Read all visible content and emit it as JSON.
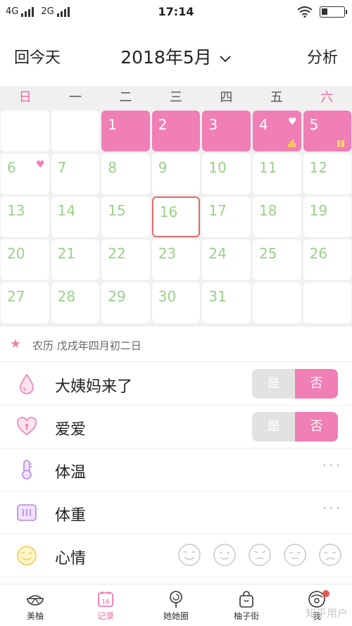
{
  "status": {
    "net1": "4G",
    "net2": "2G",
    "time": "17:14"
  },
  "header": {
    "back": "回今天",
    "title": "2018年5月",
    "right": "分析"
  },
  "calendar": {
    "weekdays": [
      "日",
      "一",
      "二",
      "三",
      "四",
      "五",
      "六"
    ],
    "weeks": [
      [
        "",
        "",
        "1",
        "2",
        "3",
        "4",
        "5"
      ],
      [
        "6",
        "7",
        "8",
        "9",
        "10",
        "11",
        "12"
      ],
      [
        "13",
        "14",
        "15",
        "16",
        "17",
        "18",
        "19"
      ],
      [
        "20",
        "21",
        "22",
        "23",
        "24",
        "25",
        "26"
      ],
      [
        "27",
        "28",
        "29",
        "30",
        "31",
        "",
        ""
      ]
    ],
    "period_days": [
      "1",
      "2",
      "3",
      "4",
      "5"
    ],
    "today": "16",
    "heart_days": [
      "4",
      "6"
    ],
    "accent_color": "#f07fb5"
  },
  "lunar": {
    "text": "农历 戊戌年四月初二日"
  },
  "rows": {
    "period": {
      "label": "大姨妈来了",
      "yes": "是",
      "no": "否"
    },
    "love": {
      "label": "爱爱",
      "yes": "是",
      "no": "否"
    },
    "temp": {
      "label": "体温",
      "more": "···"
    },
    "weight": {
      "label": "体重",
      "more": "···"
    },
    "mood": {
      "label": "心情"
    }
  },
  "nav": {
    "items": [
      {
        "label": "美柚"
      },
      {
        "label": "记录"
      },
      {
        "label": "她她圈"
      },
      {
        "label": "柚子街"
      },
      {
        "label": "我"
      }
    ],
    "watermark": "知乎用户"
  }
}
